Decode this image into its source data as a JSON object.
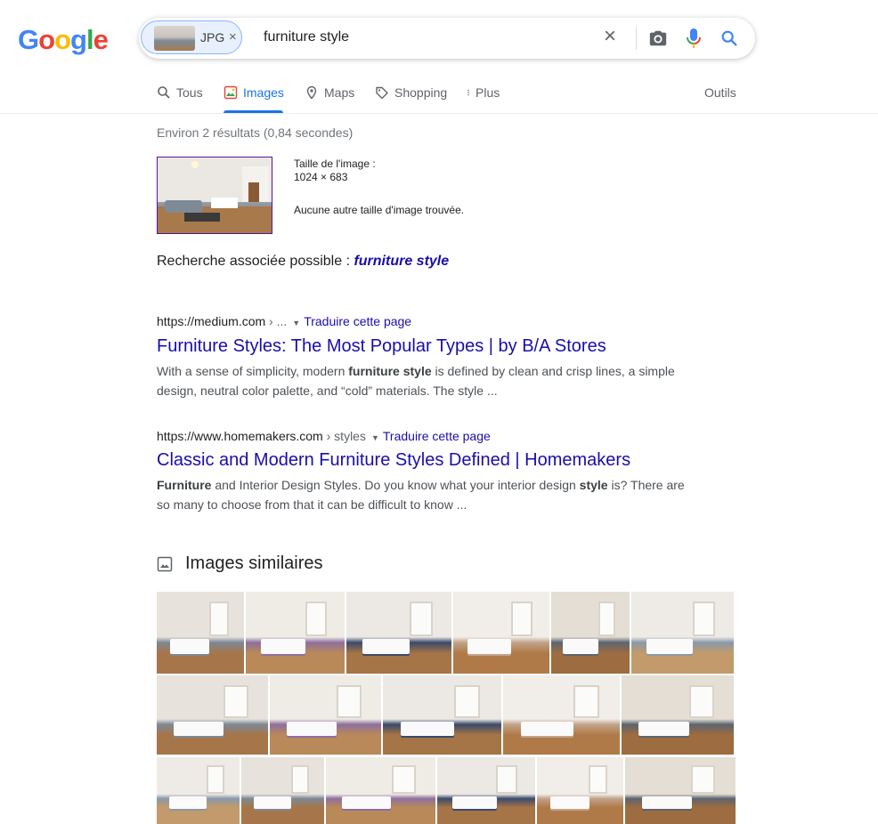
{
  "logo": {
    "letters": [
      "G",
      "o",
      "o",
      "g",
      "l",
      "e"
    ],
    "colors": [
      "#4285f4",
      "#ea4335",
      "#fbbc05",
      "#4285f4",
      "#34a853",
      "#ea4335"
    ]
  },
  "search": {
    "chip_label": "JPG",
    "chip_close": "×",
    "query": "furniture style",
    "clear": "×",
    "icons": [
      "camera-icon",
      "microphone-icon",
      "search-icon"
    ]
  },
  "tabs": [
    {
      "label": "Tous",
      "icon": "search-icon"
    },
    {
      "label": "Images",
      "icon": "image-icon",
      "active": true
    },
    {
      "label": "Maps",
      "icon": "map-pin-icon"
    },
    {
      "label": "Shopping",
      "icon": "tag-icon"
    },
    {
      "label": "Plus",
      "icon": "more-vert-icon"
    }
  ],
  "tools": "Outils",
  "stats": "Environ 2 résultats (0,84 secondes)",
  "query_image": {
    "size_label": "Taille de l'image :",
    "size_value": "1024 × 683",
    "no_other": "Aucune autre taille d'image trouvée."
  },
  "related": {
    "prefix": "Recherche associée possible : ",
    "term": "furniture style"
  },
  "results": [
    {
      "url": "https://medium.com",
      "crumb": " › ...",
      "translate": "Traduire cette page",
      "title": "Furniture Styles: The Most Popular Types | by B/A Stores",
      "snippet_parts": [
        {
          "t": "With a sense of simplicity, modern ",
          "b": false
        },
        {
          "t": "furniture style",
          "b": true
        },
        {
          "t": " is defined by clean and crisp lines, a simple design, neutral color palette, and “cold” materials. The style ...",
          "b": false
        }
      ]
    },
    {
      "url": "https://www.homemakers.com",
      "crumb": " › styles",
      "translate": "Traduire cette page",
      "title": "Classic and Modern Furniture Styles Defined | Homemakers",
      "snippet_parts": [
        {
          "t": "Furniture",
          "b": true
        },
        {
          "t": " and Interior Design Styles. Do you know what your interior design ",
          "b": false
        },
        {
          "t": "style",
          "b": true
        },
        {
          "t": " is? There are so many to choose from that it can be difficult to know ...",
          "b": false
        }
      ]
    }
  ],
  "similar_title": "Images similaires",
  "colors": {
    "link": "#1a0dab",
    "accent": "#1a73e8",
    "visited": "#52188c"
  }
}
